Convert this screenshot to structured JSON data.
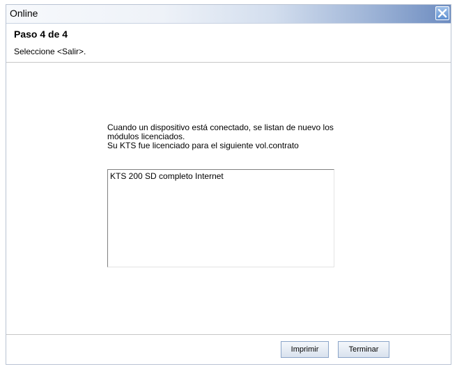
{
  "window": {
    "title": "Online",
    "close_icon": "close-x-icon"
  },
  "header": {
    "step": "Paso 4 de 4",
    "instruction": "Seleccione <Salir>."
  },
  "message": {
    "line1": "Cuando un dispositivo está conectado, se listan de nuevo los",
    "line2": "módulos licenciados.",
    "line3": "Su KTS fue licenciado para el siguiente vol.contrato"
  },
  "license_list": {
    "items": [
      "KTS 200 SD completo Internet"
    ]
  },
  "footer": {
    "print_label": "Imprimir",
    "finish_label": "Terminar"
  },
  "colors": {
    "titlebar_accent": "#6d8cc0",
    "button_border": "#8aa4c8"
  }
}
